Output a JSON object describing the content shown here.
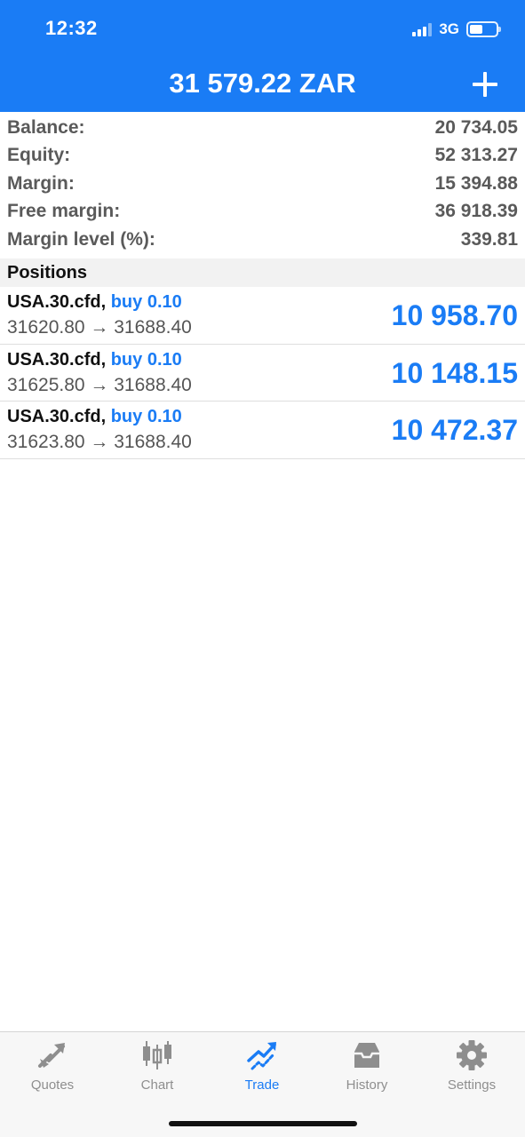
{
  "status_bar": {
    "time": "12:32",
    "network": "3G"
  },
  "header": {
    "title": "31 579.22 ZAR",
    "add_icon": "plus-icon"
  },
  "summary": [
    {
      "label": "Balance:",
      "value": "20 734.05"
    },
    {
      "label": "Equity:",
      "value": "52 313.27"
    },
    {
      "label": "Margin:",
      "value": "15 394.88"
    },
    {
      "label": "Free margin:",
      "value": "36 918.39"
    },
    {
      "label": "Margin level (%):",
      "value": "339.81"
    }
  ],
  "positions_header": "Positions",
  "positions": [
    {
      "symbol": "USA.30.cfd,",
      "side": "buy 0.10",
      "prices": "31620.80 → 31688.40",
      "profit": "10 958.70"
    },
    {
      "symbol": "USA.30.cfd,",
      "side": "buy 0.10",
      "prices": "31625.80 → 31688.40",
      "profit": "10 148.15"
    },
    {
      "symbol": "USA.30.cfd,",
      "side": "buy 0.10",
      "prices": "31623.80 → 31688.40",
      "profit": "10 472.37"
    }
  ],
  "tabs": [
    {
      "label": "Quotes",
      "icon": "quotes-icon"
    },
    {
      "label": "Chart",
      "icon": "chart-icon"
    },
    {
      "label": "Trade",
      "icon": "trade-icon",
      "active": true
    },
    {
      "label": "History",
      "icon": "history-icon"
    },
    {
      "label": "Settings",
      "icon": "settings-icon"
    }
  ],
  "colors": {
    "accent": "#1a7cf5",
    "inactive": "#8e8e8e"
  }
}
